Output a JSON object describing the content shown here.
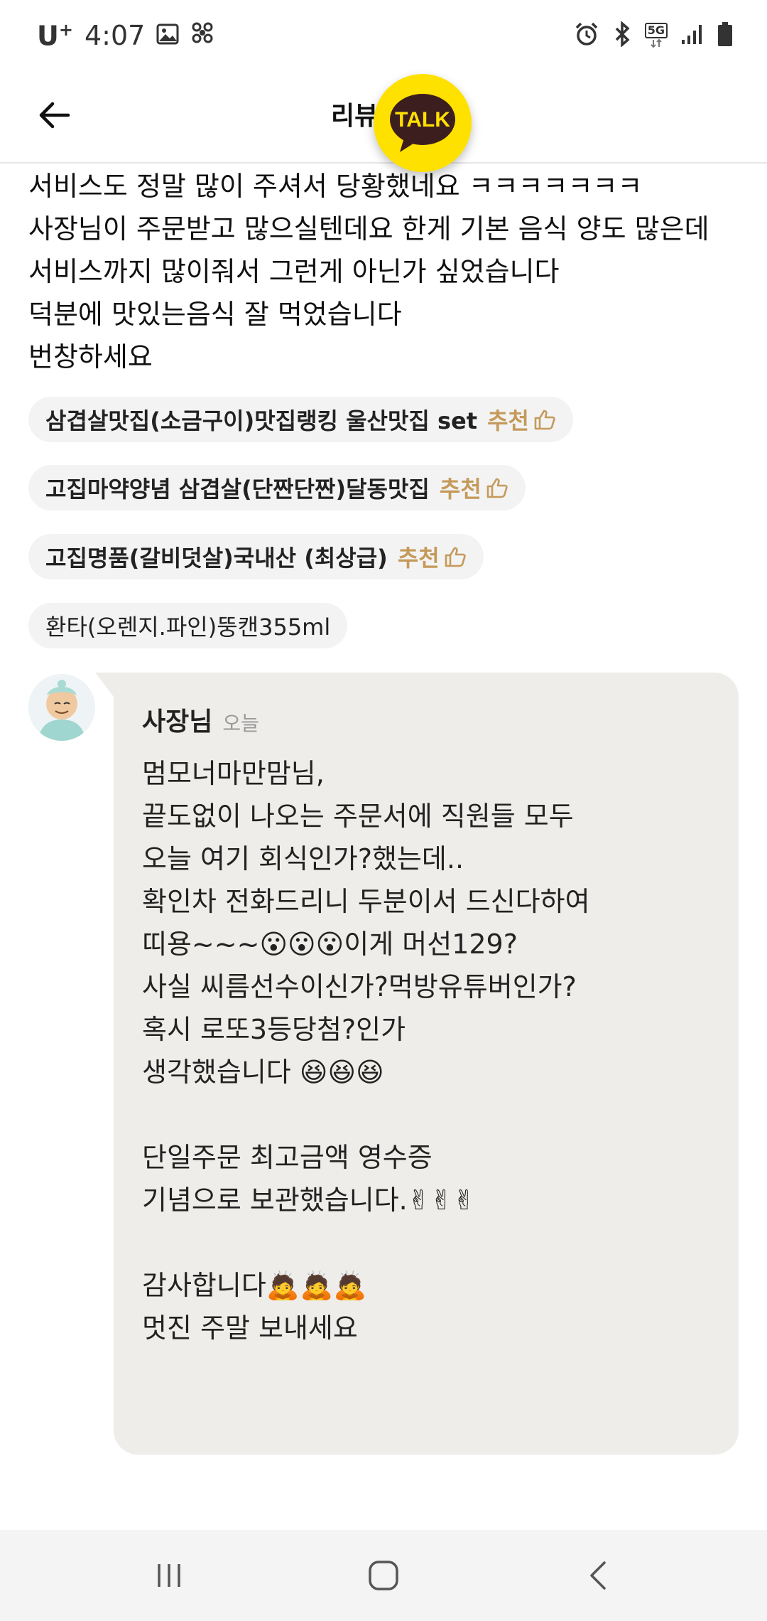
{
  "status_bar": {
    "carrier": "U",
    "carrier_sup": "+",
    "time": "4:07",
    "network": "5G"
  },
  "header": {
    "title": "리뷰",
    "talk_label": "TALK",
    "talk_color": "#ffe100"
  },
  "review": {
    "lines": [
      "서비스도 정말 많이 주셔서 당황했네요 ㅋㅋㅋㅋㅋㅋㅋ",
      "사장님이 주문받고 많으실텐데요 한게 기본 음식 양도 많은데",
      "서비스까지 많이줘서 그런게 아닌가 싶었습니다",
      "덕분에 맛있는음식 잘 먹었습니다",
      "번창하세요"
    ],
    "menu_items": [
      {
        "name": "삼겹살맛집(소금구이)맛집랭킹 울산맛집 set",
        "recommend": "추천"
      },
      {
        "name": "고집마약양념 삼겹살(단짠단짠)달동맛집",
        "recommend": "추천"
      },
      {
        "name": "고집명품(갈비덧살)국내산 (최상급)",
        "recommend": "추천"
      },
      {
        "name": "환타(오렌지.파인)뚱캔355ml"
      }
    ],
    "accent_color": "#c49a5a"
  },
  "reply": {
    "owner": "사장님",
    "date": "오늘",
    "lines": [
      "멈모너마만맘님,",
      "끝도없이 나오는 주문서에 직원들 모두",
      "오늘 여기 회식인가?했는데..",
      "확인차 전화드리니 두분이서 드신다하여",
      "띠용~~~😮😮😮이게 머선129?",
      "사실 씨름선수이신가?먹방유튜버인가?",
      "혹시 로또3등당첨?인가",
      "생각했습니다 😆😆😆",
      "",
      "단일주문 최고금액 영수증",
      "기념으로 보관했습니다.✌✌✌",
      "",
      "감사합니다🙇🙇🙇",
      "멋진 주말 보내세요"
    ],
    "bubble_color": "#efedea"
  },
  "nav_bar": {
    "icons": [
      "recent-apps-icon",
      "home-icon",
      "back-icon"
    ]
  }
}
